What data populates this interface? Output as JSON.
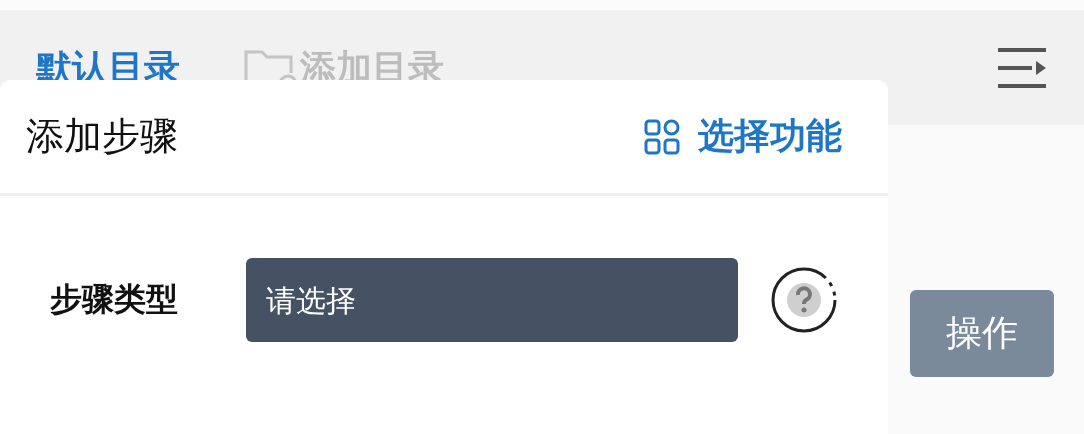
{
  "tabs": [
    {
      "label": "默认目录",
      "selected": true
    }
  ],
  "add_tab": {
    "label": "添加目录"
  },
  "dialog": {
    "title": "添加步骤",
    "action": {
      "label": "选择功能"
    },
    "fields": [
      {
        "label": "步骤类型",
        "placeholder": "请选择"
      }
    ]
  },
  "side_button": {
    "label": "操作"
  }
}
